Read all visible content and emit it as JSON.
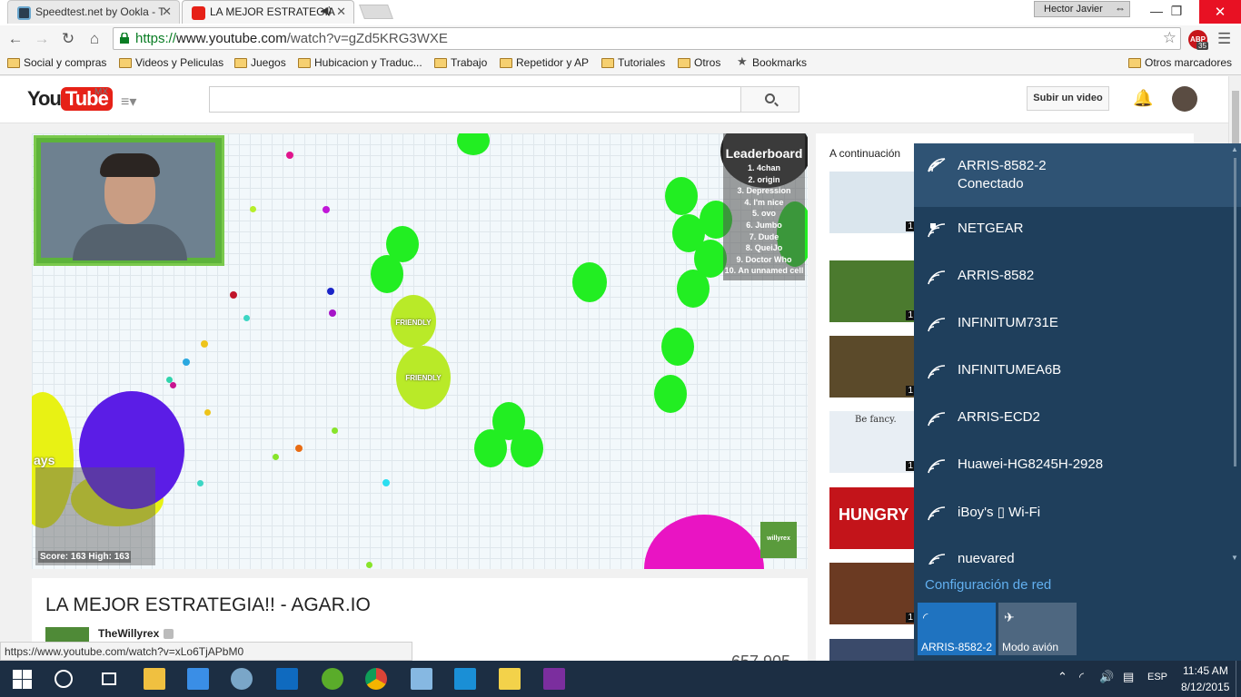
{
  "browser": {
    "tabs": [
      {
        "title": "Speedtest.net by Ookla - T",
        "active": false,
        "favicon": "speedtest-icon"
      },
      {
        "title": "LA MEJOR ESTRATEGIA",
        "active": true,
        "favicon": "youtube-icon",
        "audio": "speaker-icon"
      }
    ],
    "profile_name": "Hector Javier",
    "url_secure": "https://",
    "url_host": "www.youtube.com",
    "url_path": "/watch?v=gZd5KRG3WXE",
    "abp_label": "ABP",
    "abp_count": "35",
    "bookmarks": [
      "Social y compras",
      "Videos y Peliculas",
      "Juegos",
      "Hubicacion y Traduc...",
      "Trabajo",
      "Repetidor y AP",
      "Tutoriales",
      "Otros",
      "Bookmarks"
    ],
    "other_bookmarks": "Otros marcadores",
    "status_url": "https://www.youtube.com/watch?v=xLo6TjAPbM0"
  },
  "youtube": {
    "logo_you": "You",
    "logo_tube": "Tube",
    "region": "MX",
    "upload_label": "Subir un video",
    "video_title": "LA MEJOR ESTRATEGIA!! - AGAR.IO",
    "channel": "TheWillyrex",
    "view_count": "657,905",
    "up_next": "A continuación",
    "thumb_durations": [
      "1",
      "1",
      "1",
      "1",
      "1",
      "1"
    ],
    "thumb_hungry": "HUNGRY",
    "thumb_befancy": "Be fancy."
  },
  "game": {
    "leaderboard_title": "Leaderboard",
    "leaderboard": [
      "1. 4chan",
      "2. origin",
      "3. Depression",
      "4. I'm nice",
      "5. ovo",
      "6. Jumbo",
      "7. Dude",
      "8. QueiJo",
      "9. Doctor Who",
      "10. An unnamed cell"
    ],
    "score": "Score: 163  High: 163",
    "friendly_label": "FRIENDLY",
    "cell_name": "ays",
    "watermark": "willyrex"
  },
  "network": {
    "networks": [
      {
        "name": "ARRIS-8582-2",
        "status": "Conectado",
        "secured": false
      },
      {
        "name": "NETGEAR",
        "status": "",
        "secured": true
      },
      {
        "name": "ARRIS-8582",
        "status": "",
        "secured": false
      },
      {
        "name": "INFINITUM731E",
        "status": "",
        "secured": false
      },
      {
        "name": "INFINITUMEA6B",
        "status": "",
        "secured": false
      },
      {
        "name": "ARRIS-ECD2",
        "status": "",
        "secured": false
      },
      {
        "name": "Huawei-HG8245H-2928",
        "status": "",
        "secured": false
      },
      {
        "name": "iBoy's ▯ Wi-Fi",
        "status": "",
        "secured": false
      },
      {
        "name": "nuevared",
        "status": "",
        "secured": false
      }
    ],
    "settings_link": "Configuración de red",
    "quick_wifi": "ARRIS-8582-2",
    "quick_airplane": "Modo avión"
  },
  "taskbar": {
    "language": "ESP",
    "time": "11:45 AM",
    "date": "8/12/2015"
  },
  "colors": {
    "flyout_bg": "#1f3f5c",
    "flyout_selected": "#2f5374",
    "link_blue": "#62b0f0",
    "youtube_red": "#e62117",
    "agar_green": "#22ee22"
  }
}
